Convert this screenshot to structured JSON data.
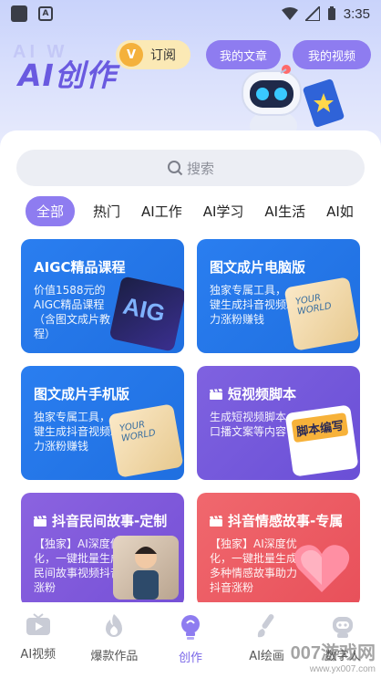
{
  "status_bar": {
    "time": "3:35"
  },
  "header": {
    "brand": "AI创作",
    "brand_ghost": "AI W",
    "subscribe_label": "订阅",
    "subscribe_badge": "V",
    "my_articles": "我的文章",
    "my_videos": "我的视频"
  },
  "search": {
    "placeholder": "搜索"
  },
  "tabs": [
    {
      "label": "全部",
      "active": true
    },
    {
      "label": "热门"
    },
    {
      "label": "AI工作"
    },
    {
      "label": "AI学习"
    },
    {
      "label": "AI生活"
    },
    {
      "label": "AI如"
    }
  ],
  "cards": [
    {
      "title": "AIGC精品课程",
      "desc": "价值1588元的AIGC精品课程（含图文成片教程）",
      "art_text": "AIG",
      "color": "blue"
    },
    {
      "title": "图文成片电脑版",
      "desc": "独家专属工具，一键生成抖音视频助力涨粉赚钱",
      "art_text": "YOUR WORLD",
      "color": "blue"
    },
    {
      "title": "图文成片手机版",
      "desc": "独家专属工具，一键生成抖音视频助力涨粉赚钱",
      "art_text": "YOUR WORLD",
      "color": "blue"
    },
    {
      "title": "短视频脚本",
      "desc": "生成短视频脚本、口播文案等内容",
      "art_text": "脚本编写",
      "color": "violet"
    },
    {
      "title": "抖音民间故事-定制",
      "desc": "【独家】AI深度优化，一键批量生成民间故事视频抖音涨粉",
      "color": "purple"
    },
    {
      "title": "抖音情感故事-专属",
      "desc": "【独家】AI深度优化，一键批量生成多种情感故事助力抖音涨粉",
      "color": "red"
    }
  ],
  "nav": [
    {
      "label": "AI视频",
      "icon": "tv-icon"
    },
    {
      "label": "爆款作品",
      "icon": "flame-icon"
    },
    {
      "label": "创作",
      "icon": "bulb-icon",
      "active": true
    },
    {
      "label": "AI绘画",
      "icon": "brush-icon"
    },
    {
      "label": "数字人",
      "icon": "avatar-icon"
    }
  ],
  "watermark": {
    "main": "007游戏网",
    "sub": "www.yx007.com"
  },
  "colors": {
    "accent": "#8e7cf0",
    "blue_card": "#2176e8",
    "violet_card": "#7258dc"
  }
}
